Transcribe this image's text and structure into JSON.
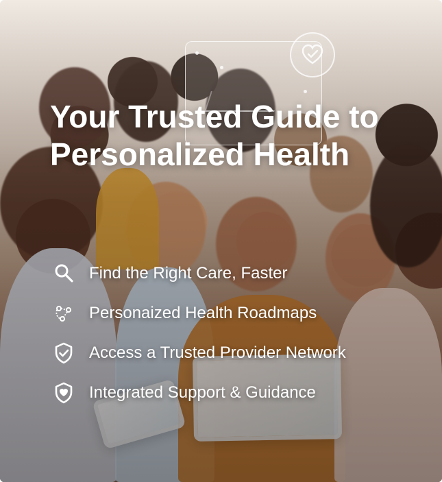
{
  "hero": {
    "headline_line_1": "Your Trusted Guide to",
    "headline_line_2": "Personalized Health",
    "background_image": "group of smiling people looking at tablets"
  },
  "features": [
    {
      "icon": "search-icon",
      "label": "Find the Right Care, Faster"
    },
    {
      "icon": "roadmap-icon",
      "label": "Personaized Health Roadmaps"
    },
    {
      "icon": "shield-check-icon",
      "label": "Access a Trusted Provider Network"
    },
    {
      "icon": "heart-shield-icon",
      "label": "Integrated Support & Guidance"
    }
  ],
  "colors": {
    "text": "#ffffff",
    "overlay_warm": "#96705a",
    "overlay_dark": "#2b1c13"
  }
}
